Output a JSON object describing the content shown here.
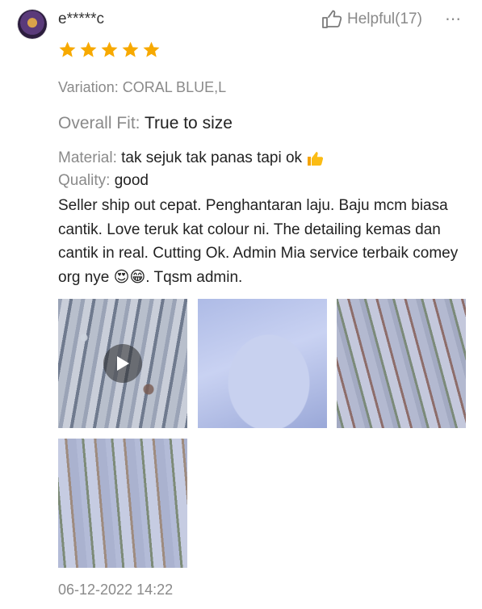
{
  "review": {
    "username": "e*****c",
    "helpful_label": "Helpful(17)",
    "more_label": "⋯",
    "rating": 5,
    "variation": "Variation: CORAL BLUE,L",
    "overall_fit": {
      "label": "Overall Fit:",
      "value": "True to size"
    },
    "material": {
      "label": "Material:",
      "value": "tak sejuk tak panas tapi ok"
    },
    "quality": {
      "label": "Quality:",
      "value": "good"
    },
    "comment": {
      "text": "Seller ship out cepat. Penghantaran laju. Baju mcm biasa cantik. Love teruk kat colour ni. The detailing kemas dan cantik in real. Cutting Ok. Admin Mia service terbaik comey org nye",
      "emojis": "😍😁",
      "ending": ". Tqsm admin."
    },
    "media": [
      {
        "kind": "video",
        "icon": "play-icon"
      },
      {
        "kind": "image"
      },
      {
        "kind": "image"
      },
      {
        "kind": "image"
      }
    ],
    "timestamp": "06-12-2022 14:22"
  },
  "colors": {
    "star": "#f7a900",
    "muted_text": "#8a8a8a",
    "body_text": "#222222"
  }
}
